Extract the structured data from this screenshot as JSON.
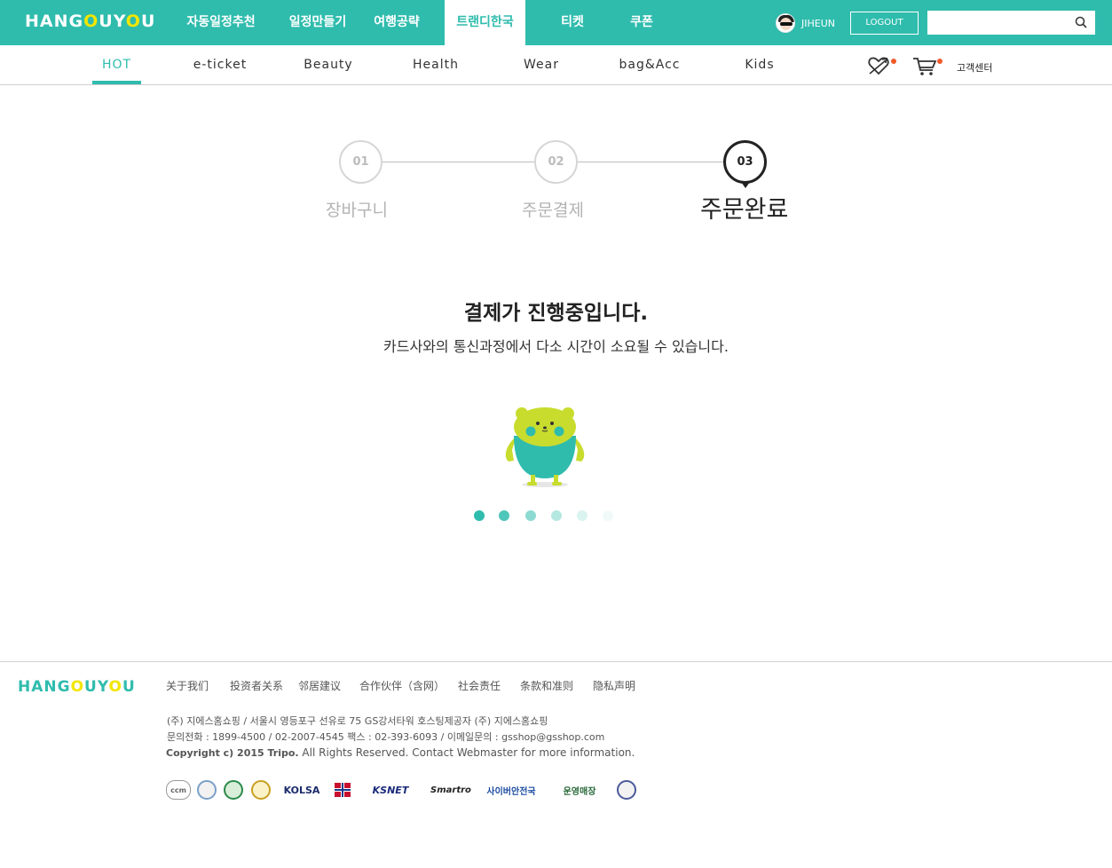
{
  "header": {
    "logo": {
      "part1": "HANG",
      "o1": "O",
      "part2": "UY",
      "o2": "O",
      "part3": "U"
    },
    "nav": [
      "자동일정추천",
      "일정만들기",
      "여행공략",
      "트랜디한국",
      "티켓",
      "쿠폰"
    ],
    "active_nav": "트랜디한국",
    "user_name": "JIHEUN",
    "logout_label": "LOGOUT",
    "search_placeholder": ""
  },
  "subnav": {
    "categories": [
      "HOT",
      "e-ticket",
      "Beauty",
      "Health",
      "Wear",
      "bag&Acc",
      "Kids"
    ],
    "active_category": "HOT",
    "customer_center": "고객센터"
  },
  "steps": [
    {
      "number": "01",
      "label": "장바구니"
    },
    {
      "number": "02",
      "label": "주문결제"
    },
    {
      "number": "03",
      "label": "주문완료"
    }
  ],
  "current_step": 3,
  "message": {
    "title": "결제가 진행중입니다.",
    "subtitle": "카드사와의 통신과정에서 다소 시간이 소요될 수 있습니다."
  },
  "loader_dot_count": 6,
  "footer": {
    "logo": {
      "part1": "HANG",
      "o1": "O",
      "part2": "UY",
      "o2": "O",
      "part3": "U"
    },
    "links": [
      "关于我们",
      "投资者关系",
      "邻居建议",
      "合作伙伴（含网）",
      "社会责任",
      "条款和准则",
      "隐私声明"
    ],
    "address": "(주) 지에스홈쇼핑  / 서울시 영등포구 선유로 75 GS강서타워 호스팅제공자 (주) 지에스홈쇼핑",
    "contact": "문의전화 : 1899-4500 / 02-2007-4545 팩스 : 02-393-6093 / 이메일문의 : gsshop@gsshop.com",
    "copyright_bold": "Copyright c) 2015 Tripo.",
    "copyright_rest": " All Rights Reserved. Contact Webmaster for more information.",
    "certs": [
      "ccm",
      "KOLSA",
      "KSNET",
      "Smartro",
      "사이버안전국",
      "운영매장"
    ]
  },
  "colors": {
    "brand": "#2fbcad",
    "logo_accent": "#f2e600",
    "badge": "#f0592a",
    "mascot_head": "#c8dc2e"
  }
}
